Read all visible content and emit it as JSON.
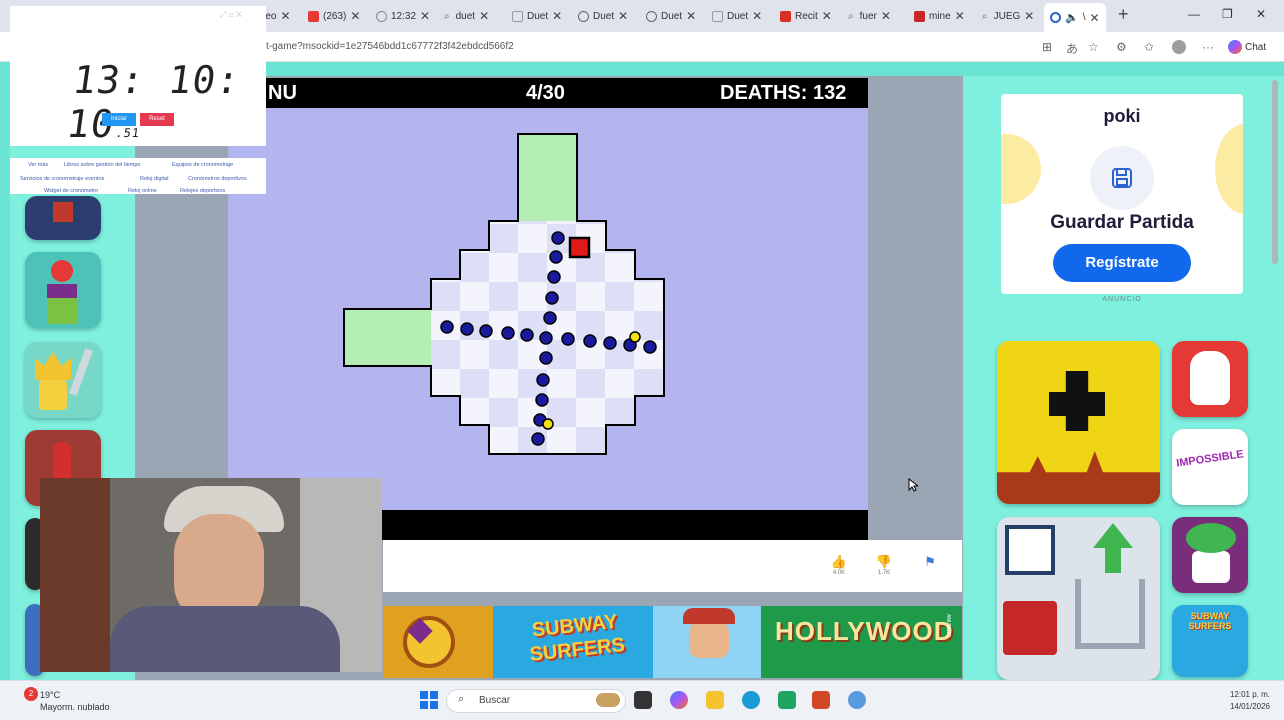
{
  "browser": {
    "tabs": [
      {
        "label": "reo",
        "icon": "mail-icon",
        "color": "#5b7bd5"
      },
      {
        "label": "(263)",
        "icon": "youtube-icon",
        "color": "#e53935"
      },
      {
        "label": "12:32",
        "icon": "check-icon",
        "color": "#888888"
      },
      {
        "label": "duet",
        "icon": "search-icon",
        "color": "#888888"
      },
      {
        "label": "Duet",
        "icon": "page-icon",
        "color": "#888888"
      },
      {
        "label": "Duet",
        "icon": "globe-icon",
        "color": "#666666"
      },
      {
        "label": "Duet",
        "icon": "globe-icon",
        "color": "#666666"
      },
      {
        "label": "Duet",
        "icon": "page-icon",
        "color": "#888888"
      },
      {
        "label": "Recit",
        "icon": "gmail-icon",
        "color": "#d93025"
      },
      {
        "label": "fuer",
        "icon": "search-icon",
        "color": "#888888"
      },
      {
        "label": "mine",
        "icon": "minecraft-icon",
        "color": "#c62828"
      },
      {
        "label": "JUEG",
        "icon": "search-icon",
        "color": "#888888"
      }
    ],
    "active_tab_label": "\\",
    "url": "t-game?msockid=1e27546bdd1c67772f3f42ebdcd566f2",
    "chat_label": "Chat"
  },
  "clock_widget": {
    "time": "13: 10: 10",
    "fraction": ".51",
    "start_label": "Iniciar",
    "reset_label": "Reset"
  },
  "link_panel": {
    "links": [
      "Ver más",
      "Libros sobre gestión del tiempo",
      "Equipos de cronometraje",
      "Servicios de cronometraje eventos",
      "Reloj digital",
      "Cronómetros deportivos",
      "Widget de cronómetro",
      "Reloj online",
      "Relojes deportivos"
    ]
  },
  "game": {
    "menu_label": "NU",
    "level": "4/30",
    "deaths": "DEATHS: 132"
  },
  "ratings": {
    "likes": "4.0K",
    "dislikes": "1.7K"
  },
  "banner": {
    "subway_text": "SUBWAY SURFERS",
    "hollywood_text": "HOLLYWOOD",
    "side_text": "ANUNCIO"
  },
  "ad": {
    "brand": "poki",
    "title": "Guardar Partida",
    "button": "Regístrate",
    "label": "ANUNCIO"
  },
  "right_thumbs": {
    "impossible_text": "IMPOSSIBLE"
  },
  "taskbar": {
    "temperature": "19°C",
    "weather": "Mayorm. nublado",
    "search_placeholder": "Buscar",
    "time": "12:01 p. m.",
    "date": "14/01/2026"
  }
}
